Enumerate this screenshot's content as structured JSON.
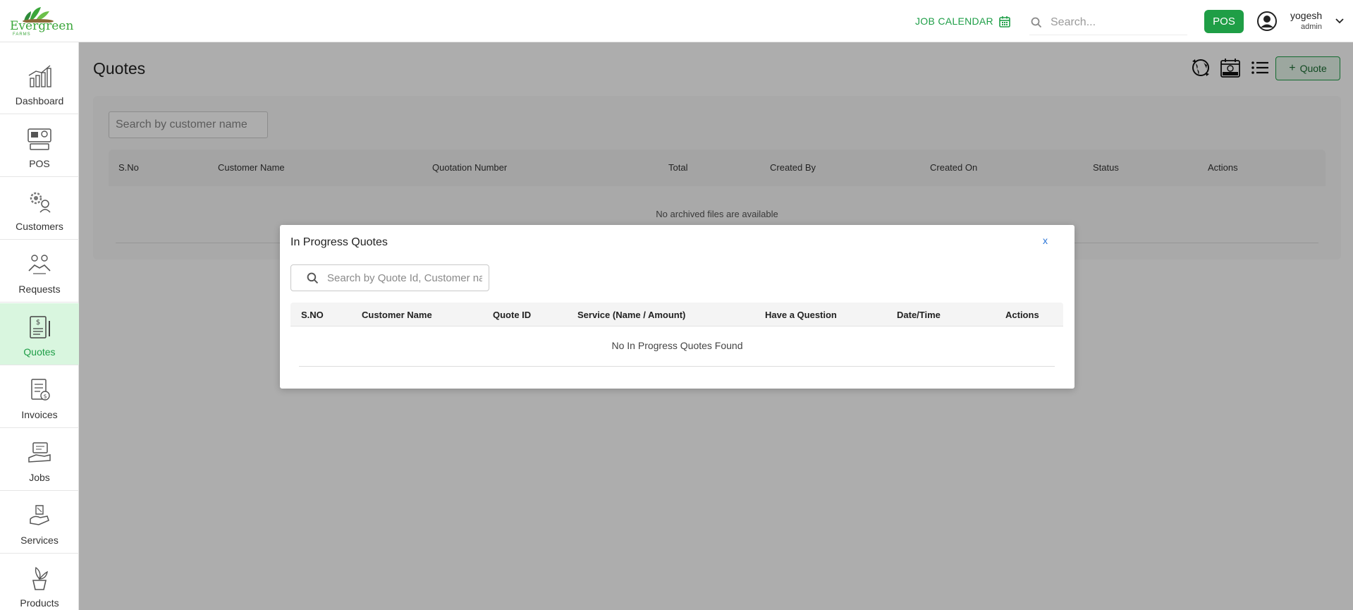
{
  "header": {
    "brand": "Evergreen",
    "brand_sub": "FARMS",
    "job_calendar": "JOB CALENDAR",
    "search_placeholder": "Search...",
    "pos_label": "POS",
    "user_name": "yogesh",
    "user_role": "admin"
  },
  "sidebar": {
    "items": [
      {
        "label": "Dashboard",
        "icon": "dashboard-chart-icon"
      },
      {
        "label": "POS",
        "icon": "pos-terminal-icon"
      },
      {
        "label": "Customers",
        "icon": "customers-gear-icon"
      },
      {
        "label": "Requests",
        "icon": "requests-handshake-icon"
      },
      {
        "label": "Quotes",
        "icon": "quotes-document-icon",
        "active": true
      },
      {
        "label": "Invoices",
        "icon": "invoices-document-icon"
      },
      {
        "label": "Jobs",
        "icon": "jobs-hand-icon"
      },
      {
        "label": "Services",
        "icon": "services-hand-icon"
      },
      {
        "label": "Products",
        "icon": "products-plant-icon"
      }
    ]
  },
  "main": {
    "title": "Quotes",
    "add_quote_label": "Quote",
    "search_placeholder": "Search by customer name",
    "columns": [
      "S.No",
      "Customer Name",
      "Quotation Number",
      "Total",
      "Created By",
      "Created On",
      "Status",
      "Actions"
    ],
    "empty_message": "No archived files are available"
  },
  "modal": {
    "title": "In Progress Quotes",
    "close_label": "x",
    "search_placeholder": "Search by Quote Id, Customer name",
    "columns": [
      "S.NO",
      "Customer Name",
      "Quote ID",
      "Service (Name / Amount)",
      "Have a Question",
      "Date/Time",
      "Actions"
    ],
    "empty_message": "No In Progress Quotes Found"
  },
  "colors": {
    "brand_green": "#1f9e46",
    "active_bg": "#d9f6df",
    "link_blue": "#2a74d6"
  }
}
